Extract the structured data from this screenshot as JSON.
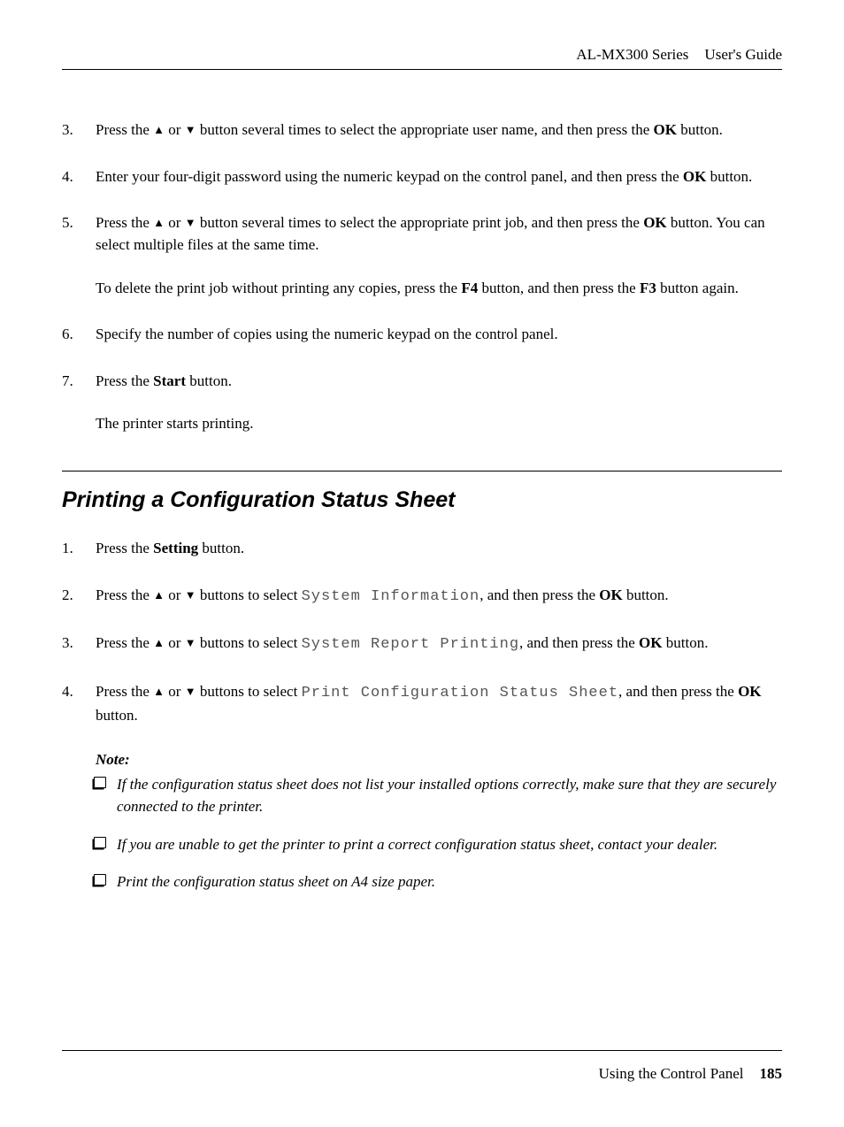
{
  "header": {
    "product": "AL-MX300 Series",
    "doc": "User's Guide"
  },
  "list1": {
    "start": 3,
    "items": [
      {
        "num": "3.",
        "pre": "Press the ",
        "mid": " or ",
        "post": " button several times to select the appropriate user name, and then press the ",
        "btn": "OK",
        "tail": " button."
      },
      {
        "num": "4.",
        "pre": "Enter your four-digit password using the numeric keypad on the control panel, and then press the ",
        "btn": "OK",
        "tail": " button."
      },
      {
        "num": "5.",
        "pre": "Press the ",
        "mid": " or ",
        "post": " button several times to select the appropriate print job, and then press the ",
        "btn": "OK",
        "tail": " button. You can select multiple files at the same time.",
        "sub_pre": "To delete the print job without printing any copies, press the ",
        "sub_b1": "F4",
        "sub_mid": " button, and then press the ",
        "sub_b2": "F3",
        "sub_tail": " button again."
      },
      {
        "num": "6.",
        "text": "Specify the number of copies using the numeric keypad on the control panel."
      },
      {
        "num": "7.",
        "pre": "Press the ",
        "btn": "Start",
        "tail": " button.",
        "sub": "The printer starts printing."
      }
    ]
  },
  "section": {
    "title": "Printing a Configuration Status Sheet"
  },
  "list2": {
    "items": [
      {
        "num": "1.",
        "pre": "Press the ",
        "btn": "Setting",
        "tail": " button."
      },
      {
        "num": "2.",
        "pre": "Press the ",
        "mid": " or ",
        "post": " buttons to select ",
        "mono": "System Information",
        "post2": ", and then press the ",
        "btn": "OK",
        "tail": " button."
      },
      {
        "num": "3.",
        "pre": "Press the ",
        "mid": " or ",
        "post": " buttons to select ",
        "mono": "System Report Printing",
        "post2": ", and then press the ",
        "btn": "OK",
        "tail": " button."
      },
      {
        "num": "4.",
        "pre": "Press the ",
        "mid": " or ",
        "post": " buttons to select ",
        "mono": "Print Configuration Status Sheet",
        "post2": ", and then press the ",
        "btn": "OK",
        "tail": " button."
      }
    ]
  },
  "note": {
    "label": "Note:",
    "items": [
      "If the configuration status sheet does not list your installed options correctly, make sure that they are securely connected to the printer.",
      "If you are unable to get the printer to print a correct configuration status sheet, contact your dealer.",
      "Print the configuration status sheet on A4 size paper."
    ]
  },
  "footer": {
    "section": "Using the Control Panel",
    "page": "185"
  },
  "glyphs": {
    "up": "▲",
    "down": "▼"
  }
}
